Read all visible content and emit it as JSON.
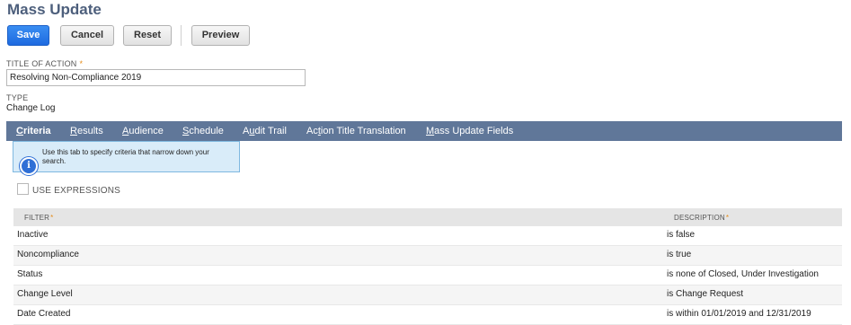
{
  "page": {
    "title": "Mass Update"
  },
  "toolbar": {
    "save_label": "Save",
    "cancel_label": "Cancel",
    "reset_label": "Reset",
    "preview_label": "Preview"
  },
  "fields": {
    "title_of_action": {
      "label": "TITLE OF ACTION",
      "required_mark": "*",
      "value": "Resolving Non-Compliance 2019"
    },
    "type": {
      "label": "TYPE",
      "value": "Change Log"
    }
  },
  "tabs": [
    {
      "label": "Criteria",
      "underline": "C",
      "rest": "riteria",
      "active": true
    },
    {
      "label": "Results",
      "underline": "R",
      "rest": "esults",
      "active": false
    },
    {
      "label": "Audience",
      "underline": "A",
      "rest": "udience",
      "active": false
    },
    {
      "label": "Schedule",
      "underline": "S",
      "rest": "chedule",
      "active": false
    },
    {
      "label": "Audit Trail",
      "pre": "A",
      "underline": "u",
      "rest": "dit Trail",
      "active": false
    },
    {
      "label": "Action Title Translation",
      "pre": "Ac",
      "underline": "t",
      "rest": "ion Title Translation",
      "active": false
    },
    {
      "label": "Mass Update Fields",
      "underline": "M",
      "rest": "ass Update Fields",
      "active": false
    }
  ],
  "tooltip": {
    "icon": "info-icon",
    "text": "Use this tab to specify criteria that narrow down your search."
  },
  "use_expressions": {
    "label": "USE EXPRESSIONS",
    "checked": false
  },
  "criteria_grid": {
    "headers": {
      "filter": "FILTER",
      "description": "DESCRIPTION",
      "required_mark": "*"
    },
    "rows": [
      {
        "filter": "Inactive",
        "description": "is false"
      },
      {
        "filter": "Noncompliance",
        "description": "is true"
      },
      {
        "filter": "Status",
        "description": "is none of Closed, Under Investigation"
      },
      {
        "filter": "Change Level",
        "description": "is Change Request"
      },
      {
        "filter": "Date Created",
        "description": "is within 01/01/2019 and 12/31/2019"
      }
    ]
  },
  "colors": {
    "primary_button": "#1e6ae0",
    "tab_bar": "#607799",
    "title": "#4d5f7c",
    "required": "#e58c1a",
    "tooltip_bg": "#d9ecf9"
  }
}
